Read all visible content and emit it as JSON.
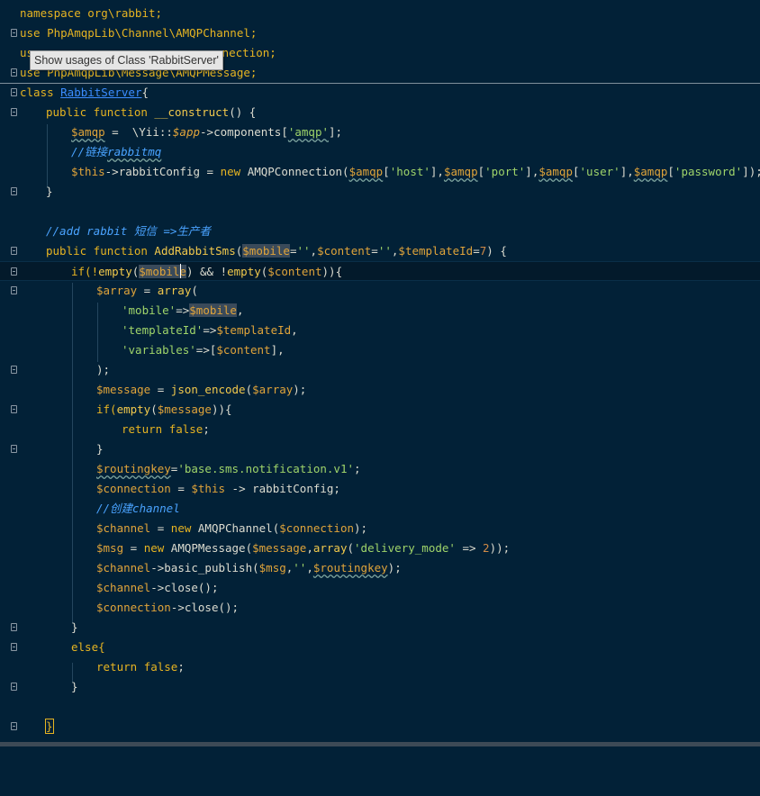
{
  "tooltip": "Show usages of Class 'RabbitServer'",
  "lines": {
    "l1": {
      "a": "namespace org\\rabbit;"
    },
    "l2": {
      "a": "use PhpAmqpLib\\Channel\\AMQPChannel;"
    },
    "l3": {
      "a": "us",
      "b": "nnection;"
    },
    "l4": {
      "a": "use PhpAmqpLib\\Message\\AMQPMessage;"
    },
    "l5": {
      "a": "class ",
      "b": "RabbitServer",
      "c": "{"
    },
    "l6": {
      "a": "public function ",
      "b": "__construct",
      "c": "() {"
    },
    "l7": {
      "a": "$amqp",
      "b": " =  \\Yii::",
      "c": "$app",
      "d": "->components[",
      "e": "'amqp'",
      "f": "];"
    },
    "l8": {
      "a": "//链接",
      "b": "rabbitmq"
    },
    "l9": {
      "a": "$this",
      "b": "->rabbitConfig = ",
      "c": "new ",
      "d": "AMQPConnection(",
      "e": "$amqp",
      "f": "[",
      "g": "'host'",
      "h": "],",
      "i": "$amqp",
      "j": "[",
      "k": "'port'",
      "l": "],",
      "m": "$amqp",
      "n": "[",
      "o": "'user'",
      "p": "],",
      "q": "$amqp",
      "r": "[",
      "s": "'password'",
      "t": "]);"
    },
    "l10": {
      "a": "}"
    },
    "l11": {
      "a": "//add rabbit 短信 =>生产者"
    },
    "l12": {
      "a": "public function ",
      "b": "AddRabbitSms",
      "c": "(",
      "d": "$mobile",
      "e": "=",
      "f": "''",
      "g": ",",
      "h": "$content",
      "i": "=",
      "j": "''",
      "k": ",",
      "l": "$templateId",
      "m": "=",
      "n": "7",
      "o": ") {"
    },
    "l13": {
      "a": "if(!",
      "b": "empty",
      "c": "(",
      "d": "$mobile",
      "e": ") && !",
      "f": "empty",
      "g": "(",
      "h": "$content",
      "i": ")){"
    },
    "l14": {
      "a": "$array",
      "b": " = ",
      "c": "array",
      "d": "("
    },
    "l15": {
      "a": "'mobile'",
      "b": "=>",
      "c": "$mobile",
      "d": ","
    },
    "l16": {
      "a": "'templateId'",
      "b": "=>",
      "c": "$templateId",
      "d": ","
    },
    "l17": {
      "a": "'variables'",
      "b": "=>[",
      "c": "$content",
      "d": "],"
    },
    "l18": {
      "a": ");"
    },
    "l19": {
      "a": "$message",
      "b": " = ",
      "c": "json_encode",
      "d": "(",
      "e": "$array",
      "f": ");"
    },
    "l20": {
      "a": "if(",
      "b": "empty",
      "c": "(",
      "d": "$message",
      "e": ")){"
    },
    "l21": {
      "a": "return ",
      "b": "false",
      "c": ";"
    },
    "l22": {
      "a": "}"
    },
    "l23": {
      "a": "$routingkey",
      "b": "=",
      "c": "'base.sms.notification.v1'",
      "d": ";"
    },
    "l24": {
      "a": "$connection",
      "b": " = ",
      "c": "$this",
      "d": " -> rabbitConfig;"
    },
    "l25": {
      "a": "//创建channel"
    },
    "l26": {
      "a": "$channel",
      "b": " = ",
      "c": "new ",
      "d": "AMQPChannel(",
      "e": "$connection",
      "f": ");"
    },
    "l27": {
      "a": "$msg",
      "b": " = ",
      "c": "new ",
      "d": "AMQPMessage(",
      "e": "$message",
      "f": ",",
      "g": "array",
      "h": "(",
      "i": "'delivery_mode'",
      "j": " => ",
      "k": "2",
      "l": "));"
    },
    "l28": {
      "a": "$channel",
      "b": "->basic_publish(",
      "c": "$msg",
      "d": ",",
      "e": "''",
      "f": ",",
      "g": "$routingkey",
      "h": ");"
    },
    "l29": {
      "a": "$channel",
      "b": "->close();"
    },
    "l30": {
      "a": "$connection",
      "b": "->close();"
    },
    "l31": {
      "a": "}"
    },
    "l32": {
      "a": "else{"
    },
    "l33": {
      "a": "return ",
      "b": "false",
      "c": ";"
    },
    "l34": {
      "a": "}"
    },
    "l36": {
      "a": "}"
    }
  }
}
